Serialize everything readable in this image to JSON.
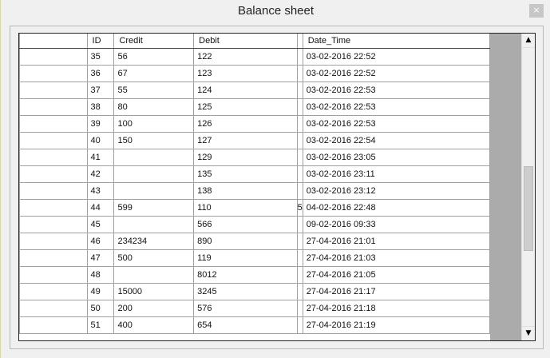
{
  "window": {
    "title": "Balance sheet",
    "close_label": "×"
  },
  "table": {
    "columns": [
      "ID",
      "Credit",
      "Debit",
      "",
      "Date_Time"
    ],
    "rows": [
      {
        "id": "35",
        "credit": "56",
        "debit": "122",
        "extra": "",
        "date": "03-02-2016 22:52"
      },
      {
        "id": "36",
        "credit": "67",
        "debit": "123",
        "extra": "",
        "date": "03-02-2016 22:52"
      },
      {
        "id": "37",
        "credit": "55",
        "debit": "124",
        "extra": "",
        "date": "03-02-2016 22:53"
      },
      {
        "id": "38",
        "credit": "80",
        "debit": "125",
        "extra": "",
        "date": "03-02-2016 22:53"
      },
      {
        "id": "39",
        "credit": "100",
        "debit": "126",
        "extra": "",
        "date": "03-02-2016 22:53"
      },
      {
        "id": "40",
        "credit": "150",
        "debit": "127",
        "extra": "",
        "date": "03-02-2016 22:54"
      },
      {
        "id": "41",
        "credit": "",
        "debit": "129",
        "extra": "",
        "date": "03-02-2016 23:05"
      },
      {
        "id": "42",
        "credit": "",
        "debit": "135",
        "extra": "",
        "date": "03-02-2016 23:11"
      },
      {
        "id": "43",
        "credit": "",
        "debit": "138",
        "extra": "",
        "date": "03-02-2016 23:12"
      },
      {
        "id": "44",
        "credit": "599",
        "debit": "110",
        "extra": "5",
        "date": "04-02-2016 22:48"
      },
      {
        "id": "45",
        "credit": "",
        "debit": " 566",
        "extra": "",
        "date": "09-02-2016 09:33"
      },
      {
        "id": "46",
        "credit": " 234234",
        "debit": "890",
        "extra": "",
        "date": "27-04-2016 21:01"
      },
      {
        "id": "47",
        "credit": " 500",
        "debit": "119",
        "extra": "",
        "date": "27-04-2016 21:03"
      },
      {
        "id": "48",
        "credit": "",
        "debit": " 8012",
        "extra": "",
        "date": "27-04-2016 21:05"
      },
      {
        "id": "49",
        "credit": " 15000",
        "debit": "3245",
        "extra": "",
        "date": "27-04-2016 21:17"
      },
      {
        "id": "50",
        "credit": "200",
        "debit": "576",
        "extra": "",
        "date": "27-04-2016 21:18"
      },
      {
        "id": "51",
        "credit": "400",
        "debit": "654",
        "extra": "",
        "date": "27-04-2016 21:19"
      }
    ]
  },
  "scrollbar": {
    "up_icon": "▲",
    "down_icon": "▼"
  }
}
